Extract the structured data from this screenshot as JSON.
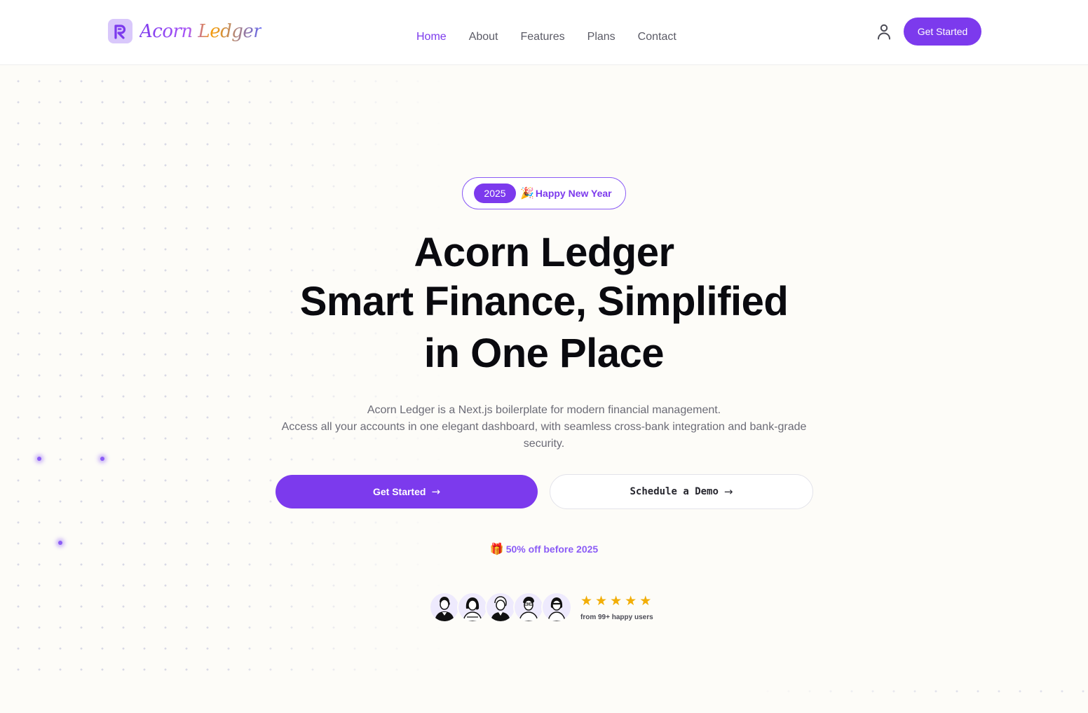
{
  "brand": {
    "name": "Acorn Ledger",
    "logo_letter": "R"
  },
  "nav": {
    "items": [
      {
        "label": "Home",
        "active": true
      },
      {
        "label": "About",
        "active": false
      },
      {
        "label": "Features",
        "active": false
      },
      {
        "label": "Plans",
        "active": false
      },
      {
        "label": "Contact",
        "active": false
      }
    ]
  },
  "header": {
    "cta_label": "Get Started",
    "user_icon": "user-icon"
  },
  "hero": {
    "badge": {
      "year": "2025",
      "emoji": "🎉",
      "text": "Happy New Year"
    },
    "headline": {
      "line1": "Acorn Ledger",
      "line2": "Smart Finance, Simplified",
      "line3": "in One Place"
    },
    "subtitle": {
      "line1": "Acorn Ledger is a Next.js boilerplate for modern financial management.",
      "line2": "Access all your accounts in one elegant dashboard, with seamless cross-bank integration and bank-grade security."
    },
    "primary_cta": "Get Started",
    "secondary_cta": "Schedule a Demo",
    "promo": {
      "emoji": "🎁",
      "text": "50% off before 2025"
    },
    "social_proof": {
      "avatar_count": 5,
      "stars": [
        "★",
        "★",
        "★",
        "★",
        "★"
      ],
      "rating": 5,
      "text": "from 99+ happy users"
    }
  },
  "colors": {
    "accent": "#7c3aed",
    "star": "#f2ae07",
    "background": "#fdfcf8"
  }
}
